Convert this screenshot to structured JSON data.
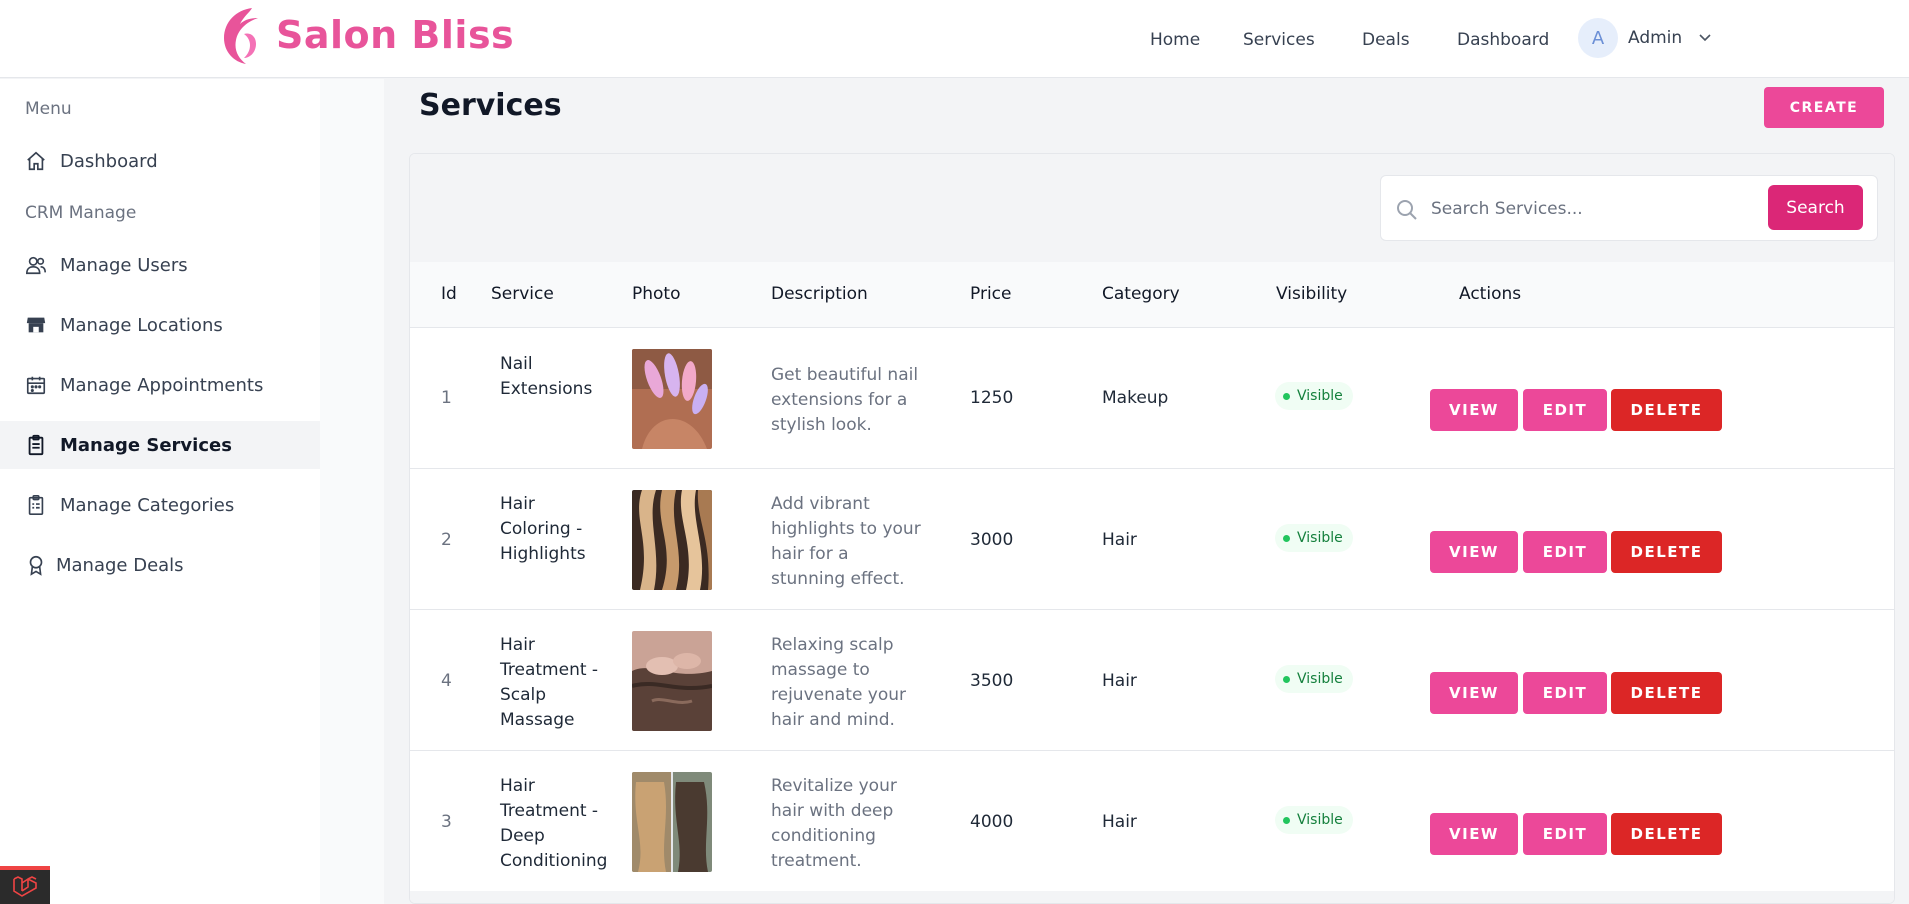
{
  "brand": {
    "name": "Salon Bliss",
    "color": "#e8549a"
  },
  "topnav": {
    "links": [
      {
        "label": "Home"
      },
      {
        "label": "Services"
      },
      {
        "label": "Deals"
      },
      {
        "label": "Dashboard"
      }
    ],
    "user": {
      "initial": "A",
      "name": "Admin"
    }
  },
  "sidebar": {
    "heading_menu": "Menu",
    "heading_crm": "CRM Manage",
    "items": [
      {
        "label": "Dashboard",
        "icon": "home-icon"
      },
      {
        "label": "Manage Users",
        "icon": "users-icon"
      },
      {
        "label": "Manage Locations",
        "icon": "store-icon"
      },
      {
        "label": "Manage Appointments",
        "icon": "calendar-icon"
      },
      {
        "label": "Manage Services",
        "icon": "clipboard-icon",
        "active": true
      },
      {
        "label": "Manage Categories",
        "icon": "clipboard-list-icon"
      },
      {
        "label": "Manage Deals",
        "icon": "award-icon"
      }
    ]
  },
  "page": {
    "title": "Services",
    "create_label": "CREATE"
  },
  "search": {
    "placeholder": "Search Services...",
    "value": "",
    "button_label": "Search"
  },
  "table": {
    "headers": {
      "id": "Id",
      "service": "Service",
      "photo": "Photo",
      "description": "Description",
      "price": "Price",
      "category": "Category",
      "visibility": "Visibility",
      "actions": "Actions"
    },
    "rows": [
      {
        "id": "1",
        "service": "Nail Extensions",
        "description": "Get beautiful nail extensions for a stylish look.",
        "price": "1250",
        "category": "Makeup",
        "visibility": "Visible",
        "photo": "nails-photo"
      },
      {
        "id": "2",
        "service": "Hair Coloring - Highlights",
        "description": "Add vibrant highlights to your hair for a stunning effect.",
        "price": "3000",
        "category": "Hair",
        "visibility": "Visible",
        "photo": "hair-highlights-photo"
      },
      {
        "id": "4",
        "service": "Hair Treatment - Scalp Massage",
        "description": "Relaxing scalp massage to rejuvenate your hair and mind.",
        "price": "3500",
        "category": "Hair",
        "visibility": "Visible",
        "photo": "scalp-massage-photo"
      },
      {
        "id": "3",
        "service": "Hair Treatment - Deep Conditioning",
        "description": "Revitalize your hair with deep conditioning treatment.",
        "price": "4000",
        "category": "Hair",
        "visibility": "Visible",
        "photo": "deep-conditioning-photo"
      }
    ],
    "actions": {
      "view": "VIEW",
      "edit": "EDIT",
      "delete": "DELETE"
    }
  },
  "colors": {
    "accent": "#ec4899",
    "accent_dark": "#db2777",
    "danger": "#dc2626",
    "visible_green": "#15803d"
  }
}
